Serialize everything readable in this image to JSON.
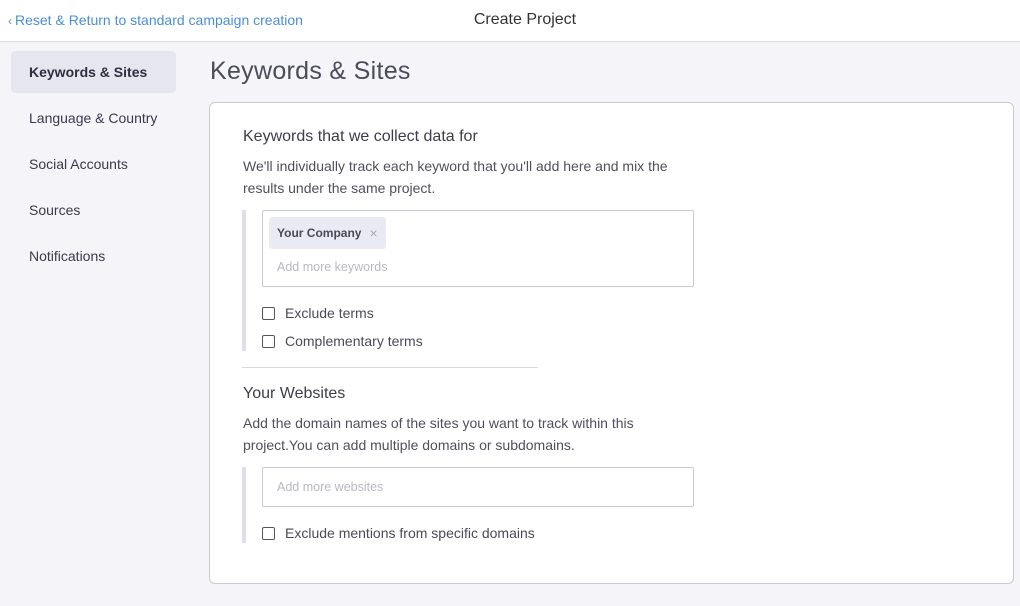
{
  "topbar": {
    "back_chevron": "‹",
    "back_link": "Reset & Return to standard campaign creation",
    "title": "Create Project"
  },
  "sidebar": {
    "items": [
      {
        "label": "Keywords & Sites",
        "active": true
      },
      {
        "label": "Language & Country"
      },
      {
        "label": "Social Accounts"
      },
      {
        "label": "Sources"
      },
      {
        "label": "Notifications"
      }
    ]
  },
  "main": {
    "title": "Keywords & Sites",
    "keywords": {
      "title": "Keywords that we collect data for",
      "description": "We'll individually track each keyword that you'll add here and mix the results under the same project.",
      "chip": "Your Company",
      "chip_remove": "×",
      "placeholder": "Add more keywords",
      "exclude_label": "Exclude terms",
      "complementary_label": "Complementary terms"
    },
    "websites": {
      "title": "Your Websites",
      "description": "Add the domain names of the sites you want to track within this project.You can add multiple domains or subdomains.",
      "placeholder": "Add more websites",
      "exclude_label": "Exclude mentions from specific domains"
    }
  }
}
